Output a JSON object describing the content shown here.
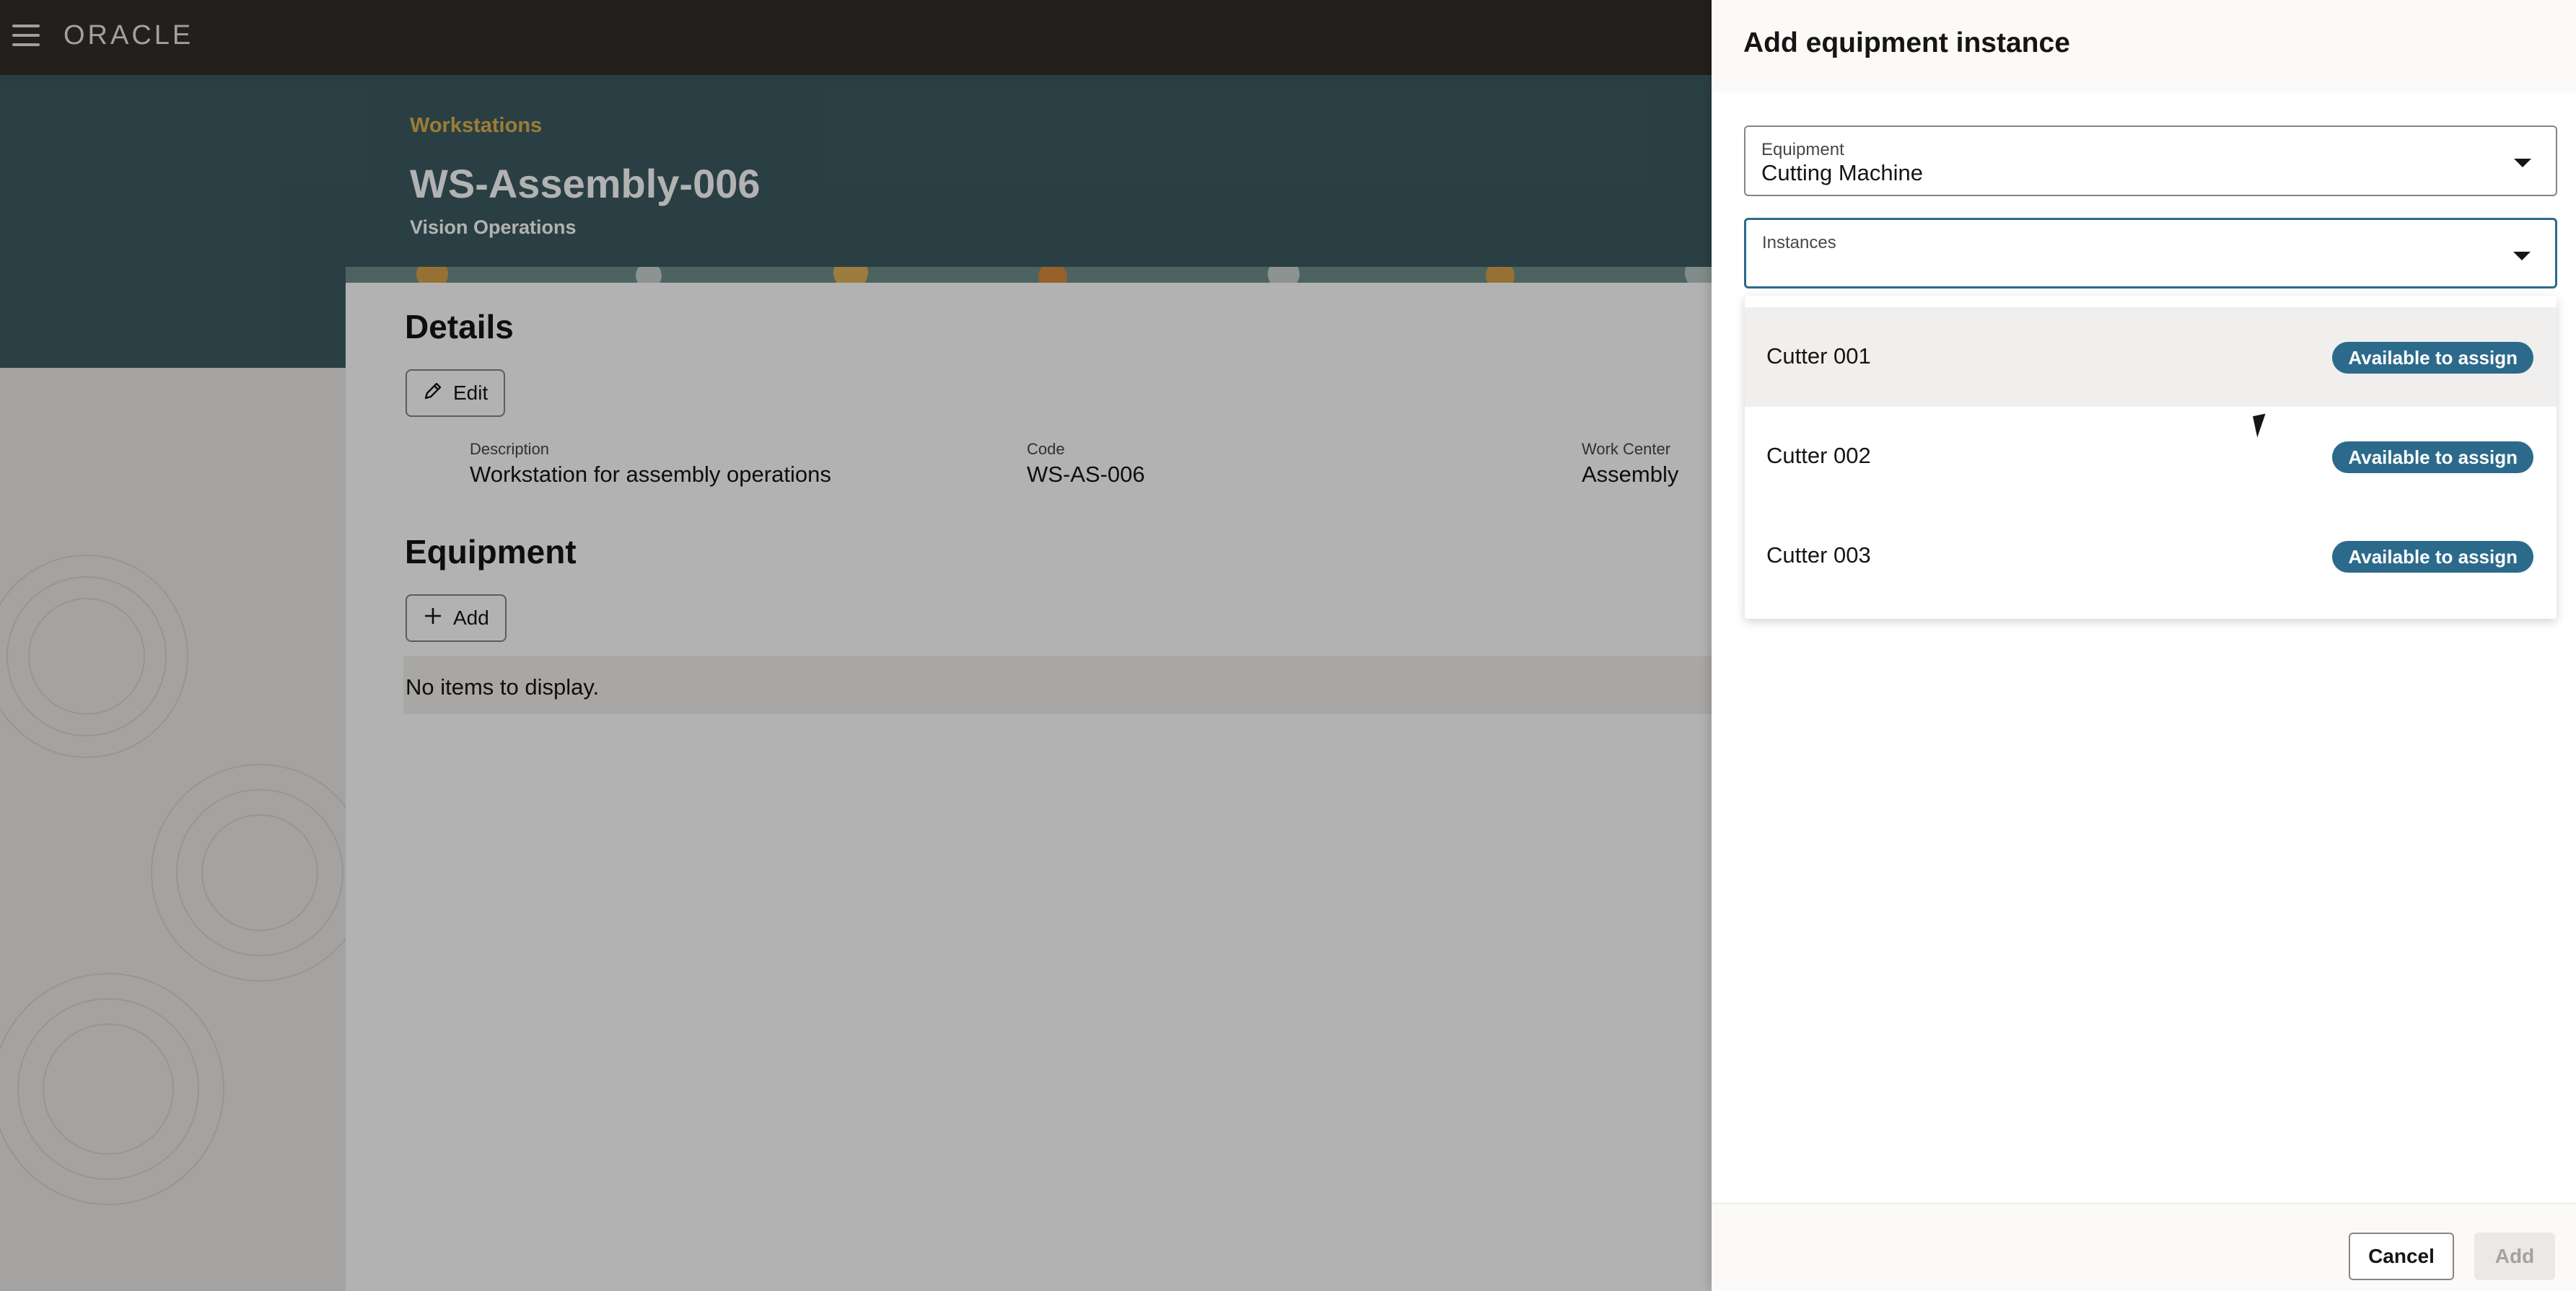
{
  "header": {
    "logo": "ORACLE"
  },
  "page": {
    "breadcrumb": "Workstations",
    "title": "WS-Assembly-006",
    "subtitle": "Vision Operations"
  },
  "details": {
    "heading": "Details",
    "edit_label": "Edit",
    "fields": [
      {
        "label": "Description",
        "value": "Workstation for assembly operations"
      },
      {
        "label": "Code",
        "value": "WS-AS-006"
      },
      {
        "label": "Work Center",
        "value": "Assembly"
      }
    ]
  },
  "equipment": {
    "heading": "Equipment",
    "add_label": "Add",
    "empty_text": "No items to display."
  },
  "drawer": {
    "title": "Add equipment instance",
    "equipment_field": {
      "label": "Equipment",
      "value": "Cutting Machine"
    },
    "instances_field": {
      "label": "Instances",
      "value": ""
    },
    "options": [
      {
        "name": "Cutter 001",
        "status": "Available to assign"
      },
      {
        "name": "Cutter 002",
        "status": "Available to assign"
      },
      {
        "name": "Cutter 003",
        "status": "Available to assign"
      }
    ],
    "cancel_label": "Cancel",
    "add_label": "Add"
  },
  "colors": {
    "accent": "#2c6a8b",
    "hero": "#3d5b62",
    "breadcrumb": "#e1b44c",
    "topbar": "#312d2a"
  }
}
